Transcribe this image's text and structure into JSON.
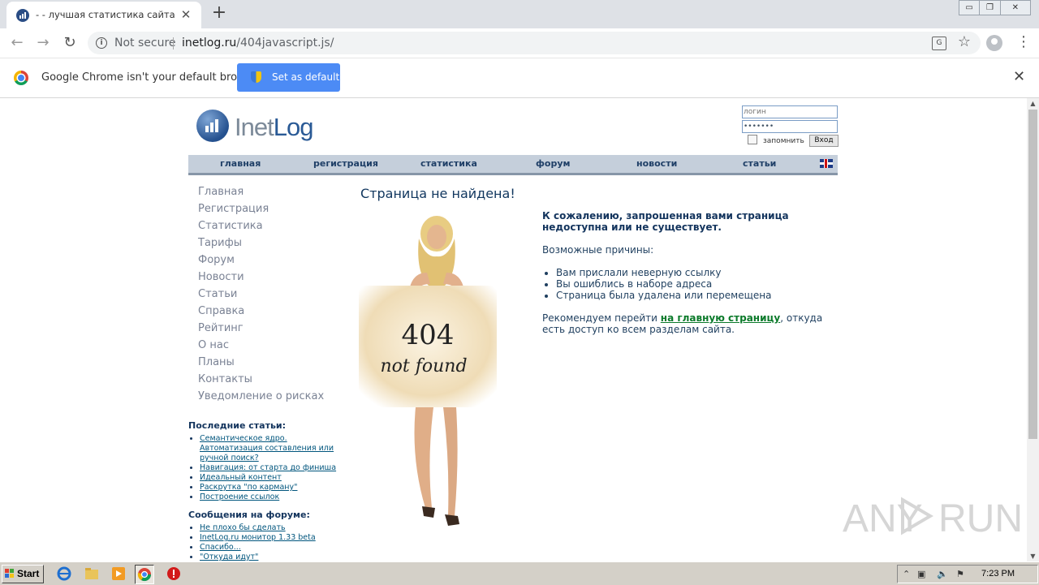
{
  "browser": {
    "tab_title": "- - лучшая статистика сайта и сче",
    "tab_close": "✕",
    "new_tab": "+",
    "address": {
      "security": "Not secure",
      "host": "inetlog.ru",
      "path": "/404javascript.js/"
    },
    "infobar": {
      "message": "Google Chrome isn't your default browser",
      "button": "Set as default",
      "close": "✕"
    },
    "window_controls": [
      "▭",
      "❐",
      "✕"
    ]
  },
  "site": {
    "logo_text_prefix": "Inet",
    "logo_text_suffix": "Log",
    "login": {
      "login_placeholder": "логин",
      "password_value": "•••••••",
      "remember": "запомнить",
      "submit": "Вход"
    },
    "top_menu": [
      "главная",
      "регистрация",
      "статистика",
      "форум",
      "новости",
      "статьи"
    ],
    "left_nav": [
      "Главная",
      "Регистрация",
      "Статистика",
      "Тарифы",
      "Форум",
      "Новости",
      "Статьи",
      "Справка",
      "Рейтинг",
      "О нас",
      "Планы",
      "Контакты",
      "Уведомление о рисках"
    ],
    "recent_articles": {
      "title": "Последние статьи:",
      "items": [
        "Семантическое ядро. Автоматизация составления или ручной поиск?",
        "Навигация: от старта до финиша",
        "Идеальный контент",
        "Раскрутка \"по карману\"",
        "Построение ссылок"
      ]
    },
    "forum_posts": {
      "title": "Сообщения на форуме:",
      "items": [
        "Не плохо бы сделать",
        "InetLog.ru монитор 1.33 beta",
        "Спасибо...",
        "\"Откуда идут\""
      ]
    },
    "heading": "Страница не найдена!",
    "figure": {
      "line1": "404",
      "line2": "not found"
    },
    "content": {
      "lead": "К сожалению, запрошенная вами страница недоступна или не существует.",
      "reasons_intro": "Возможные причины:",
      "reasons": [
        "Вам прислали неверную ссылку",
        "Вы ошиблись в наборе адреса",
        "Страница была удалена или перемещена"
      ],
      "recommend_before": "Рекомендуем перейти ",
      "recommend_link": "на главную страницу",
      "recommend_after": ", откуда есть доступ ко всем разделам сайта."
    }
  },
  "watermark": {
    "left": "ANY",
    "right": "RUN"
  },
  "taskbar": {
    "start": "Start",
    "time": "7:23 PM"
  }
}
